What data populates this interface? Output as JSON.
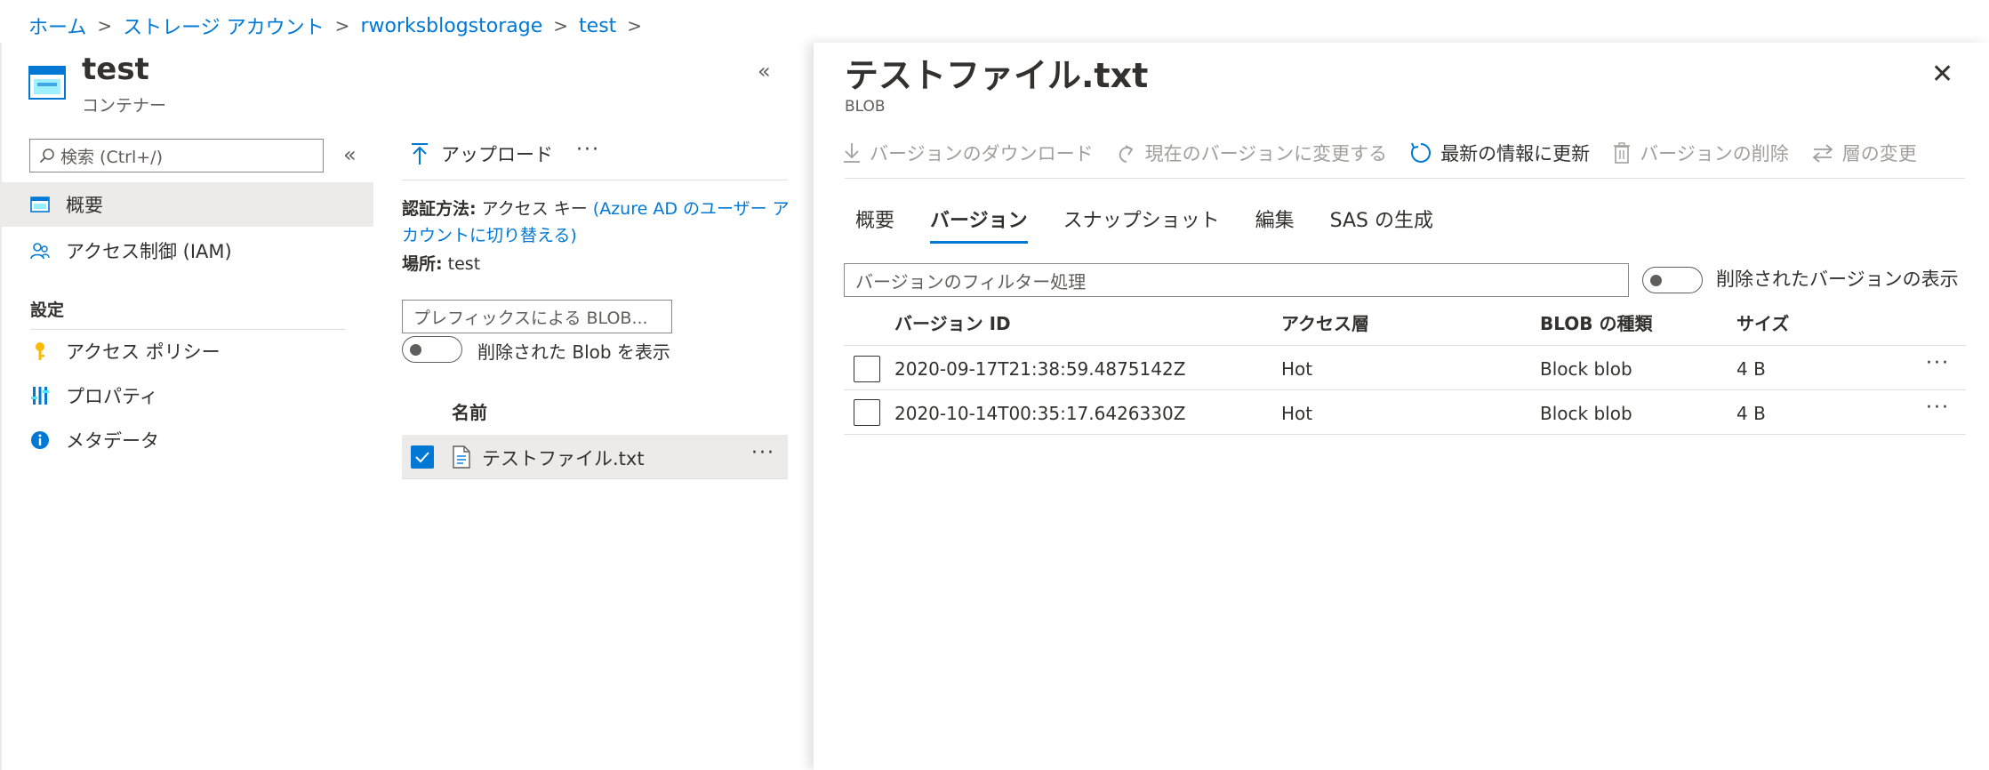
{
  "breadcrumb": [
    {
      "label": "ホーム"
    },
    {
      "label": "ストレージ アカウント"
    },
    {
      "label": "rworksblogstorage"
    },
    {
      "label": "test"
    }
  ],
  "container": {
    "title": "test",
    "subtitle": "コンテナー"
  },
  "search": {
    "placeholder": "検索 (Ctrl+/)"
  },
  "nav": {
    "overview": "概要",
    "iam": "アクセス制御 (IAM)",
    "settings_heading": "設定",
    "access_policy": "アクセス ポリシー",
    "properties": "プロパティ",
    "metadata": "メタデータ"
  },
  "middle": {
    "upload": "アップロード",
    "more": "···",
    "auth_label": "認証方法:",
    "auth_value": "アクセス キー",
    "auth_link": "(Azure AD のユーザー アカウントに切り替える)",
    "location_label": "場所:",
    "location_value": "test",
    "prefix_placeholder": "プレフィックスによる BLOB...",
    "show_deleted": "削除された Blob を表示",
    "col_name": "名前",
    "file_name": "テストファイル.txt"
  },
  "panel": {
    "title": "テストファイル.txt",
    "subtitle": "BLOB",
    "commands": {
      "download": "バージョンのダウンロード",
      "make_current": "現在のバージョンに変更する",
      "refresh": "最新の情報に更新",
      "delete": "バージョンの削除",
      "change_tier": "層の変更"
    },
    "tabs": {
      "overview": "概要",
      "versions": "バージョン",
      "snapshots": "スナップショット",
      "edit": "編集",
      "sas": "SAS の生成"
    },
    "filter_placeholder": "バージョンのフィルター処理",
    "show_deleted_versions": "削除されたバージョンの表示",
    "columns": {
      "version_id": "バージョン ID",
      "tier": "アクセス層",
      "blob_type": "BLOB の種類",
      "size": "サイズ"
    },
    "rows": [
      {
        "version_id": "2020-09-17T21:38:59.4875142Z",
        "tier": "Hot",
        "blob_type": "Block blob",
        "size": "4 B"
      },
      {
        "version_id": "2020-10-14T00:35:17.6426330Z",
        "tier": "Hot",
        "blob_type": "Block blob",
        "size": "4 B"
      }
    ],
    "row_more": "···"
  },
  "colors": {
    "accent": "#0078d4",
    "selected_bg": "#edebe9",
    "text": "#323130"
  }
}
